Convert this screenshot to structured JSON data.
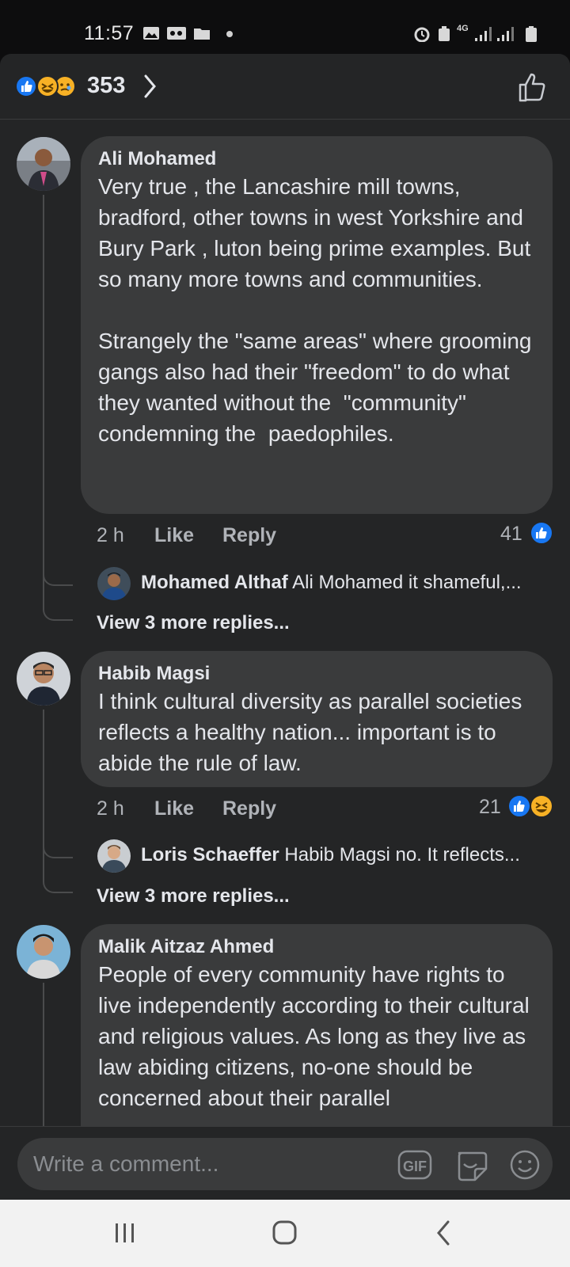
{
  "status_bar": {
    "time": "11:57",
    "network": "4G"
  },
  "header": {
    "reaction_count": "353",
    "reactions": [
      "like-icon",
      "haha-icon",
      "sad-icon"
    ]
  },
  "comments": [
    {
      "author": "Ali Mohamed",
      "text": "Very true , the Lancashire mill towns, bradford, other towns in west Yorkshire and Bury Park , luton being prime examples. But so many more towns and communities.\n\nStrangely the \"same areas\" where grooming gangs also had their \"freedom\" to do what they wanted without the  \"community\" condemning the  paedophiles.",
      "time": "2 h",
      "like_label": "Like",
      "reply_label": "Reply",
      "reaction_count": "41",
      "reply_preview": {
        "author": "Mohamed Althaf",
        "text": "Ali Mohamed  it shameful,..."
      },
      "more_replies": "View 3 more replies..."
    },
    {
      "author": "Habib Magsi",
      "text": "I think cultural diversity as parallel societies reflects a healthy nation... important is to abide the rule of law.",
      "time": "2 h",
      "like_label": "Like",
      "reply_label": "Reply",
      "reaction_count": "21",
      "reply_preview": {
        "author": "Loris Schaeffer",
        "text": "Habib Magsi no. It reflects..."
      },
      "more_replies": "View 3 more replies..."
    },
    {
      "author": "Malik Aitzaz Ahmed",
      "text": "People of every community have rights to live independently according to their cultural and religious values. As long as they live as law abiding citizens, no-one should be concerned about their parallel"
    }
  ],
  "composer": {
    "placeholder": "Write a comment...",
    "gif_label": "GIF"
  },
  "colors": {
    "background": "#242526",
    "bubble": "#3a3b3c",
    "like_blue": "#1877f2",
    "haha_yellow": "#f7b125"
  }
}
